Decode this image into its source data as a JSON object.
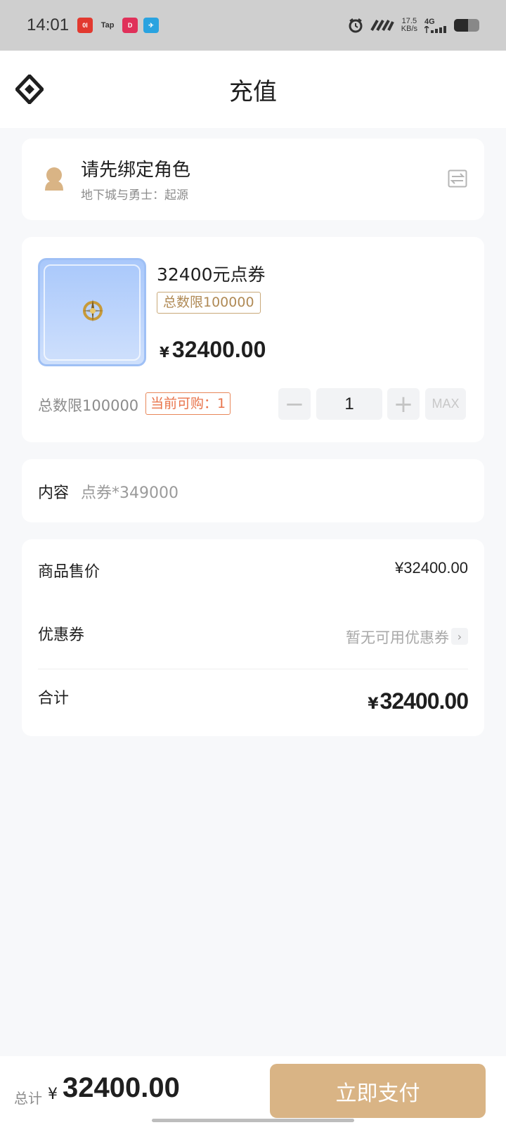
{
  "status_bar": {
    "time": "14:01",
    "net_speed_value": "17.5",
    "net_speed_unit": "KB/s",
    "network": "4G",
    "battery_level": 0.55,
    "apps": [
      {
        "icon": "news-app-icon",
        "color": "#e2392f",
        "label": "0I"
      },
      {
        "icon": "taptap-icon",
        "color": "#cfcfcf",
        "label": "Tap"
      },
      {
        "icon": "game-app-icon",
        "color": "#e0315a",
        "label": "D"
      },
      {
        "icon": "telegram-icon",
        "color": "#2aa3e0",
        "label": "✈"
      }
    ]
  },
  "header": {
    "title": "充值",
    "logo_icon": "brand-logo-icon"
  },
  "role": {
    "title": "请先绑定角色",
    "subtitle": "地下城与勇士：起源",
    "avatar_icon": "user-avatar-icon",
    "switch_icon": "switch-role-icon"
  },
  "product": {
    "name": "32400元点券",
    "limit_badge": "总数限100000",
    "currency": "¥",
    "price": "32400.00",
    "limit_text": "总数限100000",
    "buyable_badge": "当前可购：1",
    "quantity": "1",
    "minus_label": "−",
    "plus_label": "+",
    "max_label": "MAX"
  },
  "content": {
    "label": "内容",
    "value": "点券*349000"
  },
  "summary": {
    "price_label": "商品售价",
    "price_value": "¥32400.00",
    "coupon_label": "优惠券",
    "coupon_value": "暂无可用优惠券",
    "total_label": "合计",
    "total_currency": "¥",
    "total_value": "32400.00"
  },
  "bottom_bar": {
    "total_label": "总计",
    "currency": "¥",
    "amount": "32400.00",
    "pay_label": "立即支付"
  },
  "colors": {
    "accent": "#d9b485",
    "warning": "#e8734a",
    "badge_gold": "#b08a55"
  }
}
